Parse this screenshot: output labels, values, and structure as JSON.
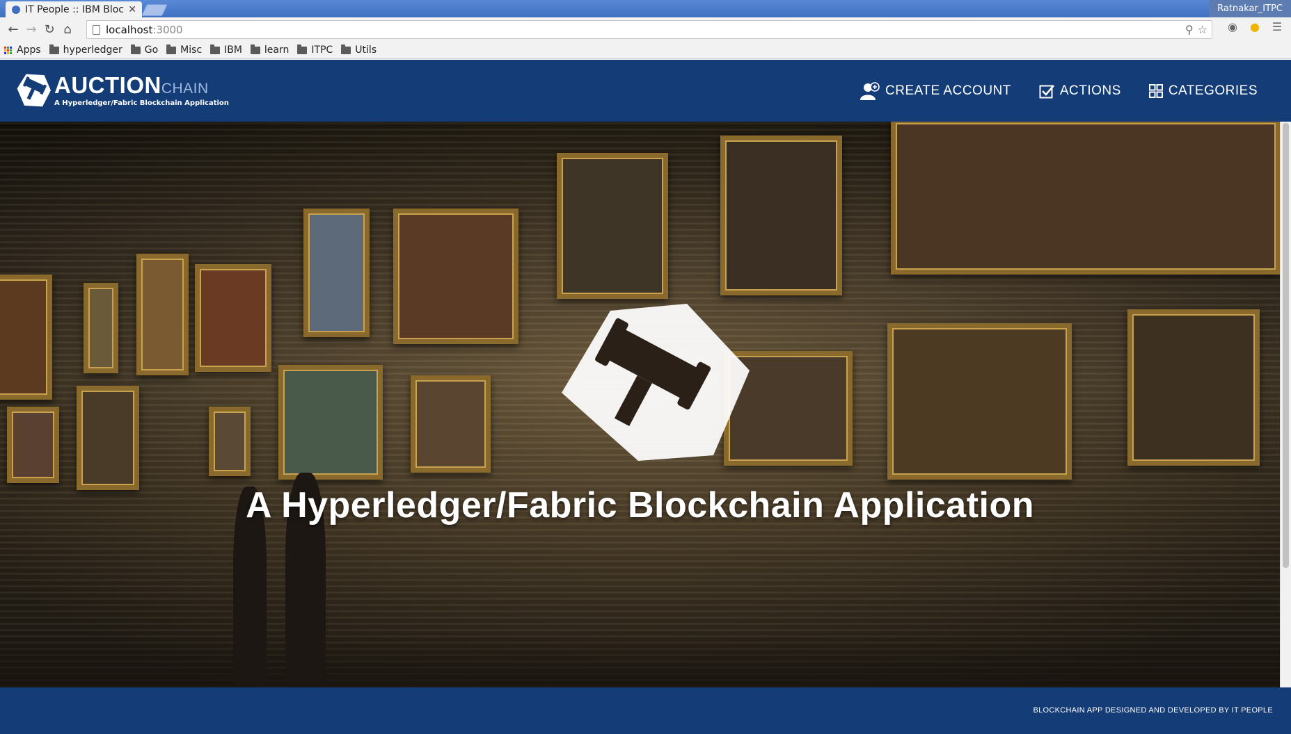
{
  "browser": {
    "tab_title": "IT People :: IBM Bloc",
    "profile_name": "Ratnakar_ITPC",
    "url_host": "localhost",
    "url_port": ":3000",
    "bookmarks": [
      {
        "label": "Apps",
        "icon": "apps-icon"
      },
      {
        "label": "hyperledger",
        "icon": "folder-icon"
      },
      {
        "label": "Go",
        "icon": "folder-icon"
      },
      {
        "label": "Misc",
        "icon": "folder-icon"
      },
      {
        "label": "IBM",
        "icon": "folder-icon"
      },
      {
        "label": "learn",
        "icon": "folder-icon"
      },
      {
        "label": "ITPC",
        "icon": "folder-icon"
      },
      {
        "label": "Utils",
        "icon": "folder-icon"
      }
    ]
  },
  "header": {
    "logo_main": "AUCTION",
    "logo_chain": "CHAIN",
    "logo_sub": "A Hyperledger/Fabric Blockchain Application",
    "nav": [
      {
        "label": "CREATE ACCOUNT",
        "icon": "user-plus-icon"
      },
      {
        "label": "ACTIONS",
        "icon": "checkbox-icon"
      },
      {
        "label": "CATEGORIES",
        "icon": "grid-icon"
      }
    ]
  },
  "hero": {
    "title": "A Hyperledger/Fabric Blockchain Application",
    "logo_icon": "gavel-hexagon-icon"
  },
  "footer": {
    "text": "BLOCKCHAIN APP DESIGNED AND DEVELOPED BY IT PEOPLE"
  },
  "colors": {
    "brand_navy": "#143d78",
    "chrome_blue": "#3f6fc0"
  }
}
